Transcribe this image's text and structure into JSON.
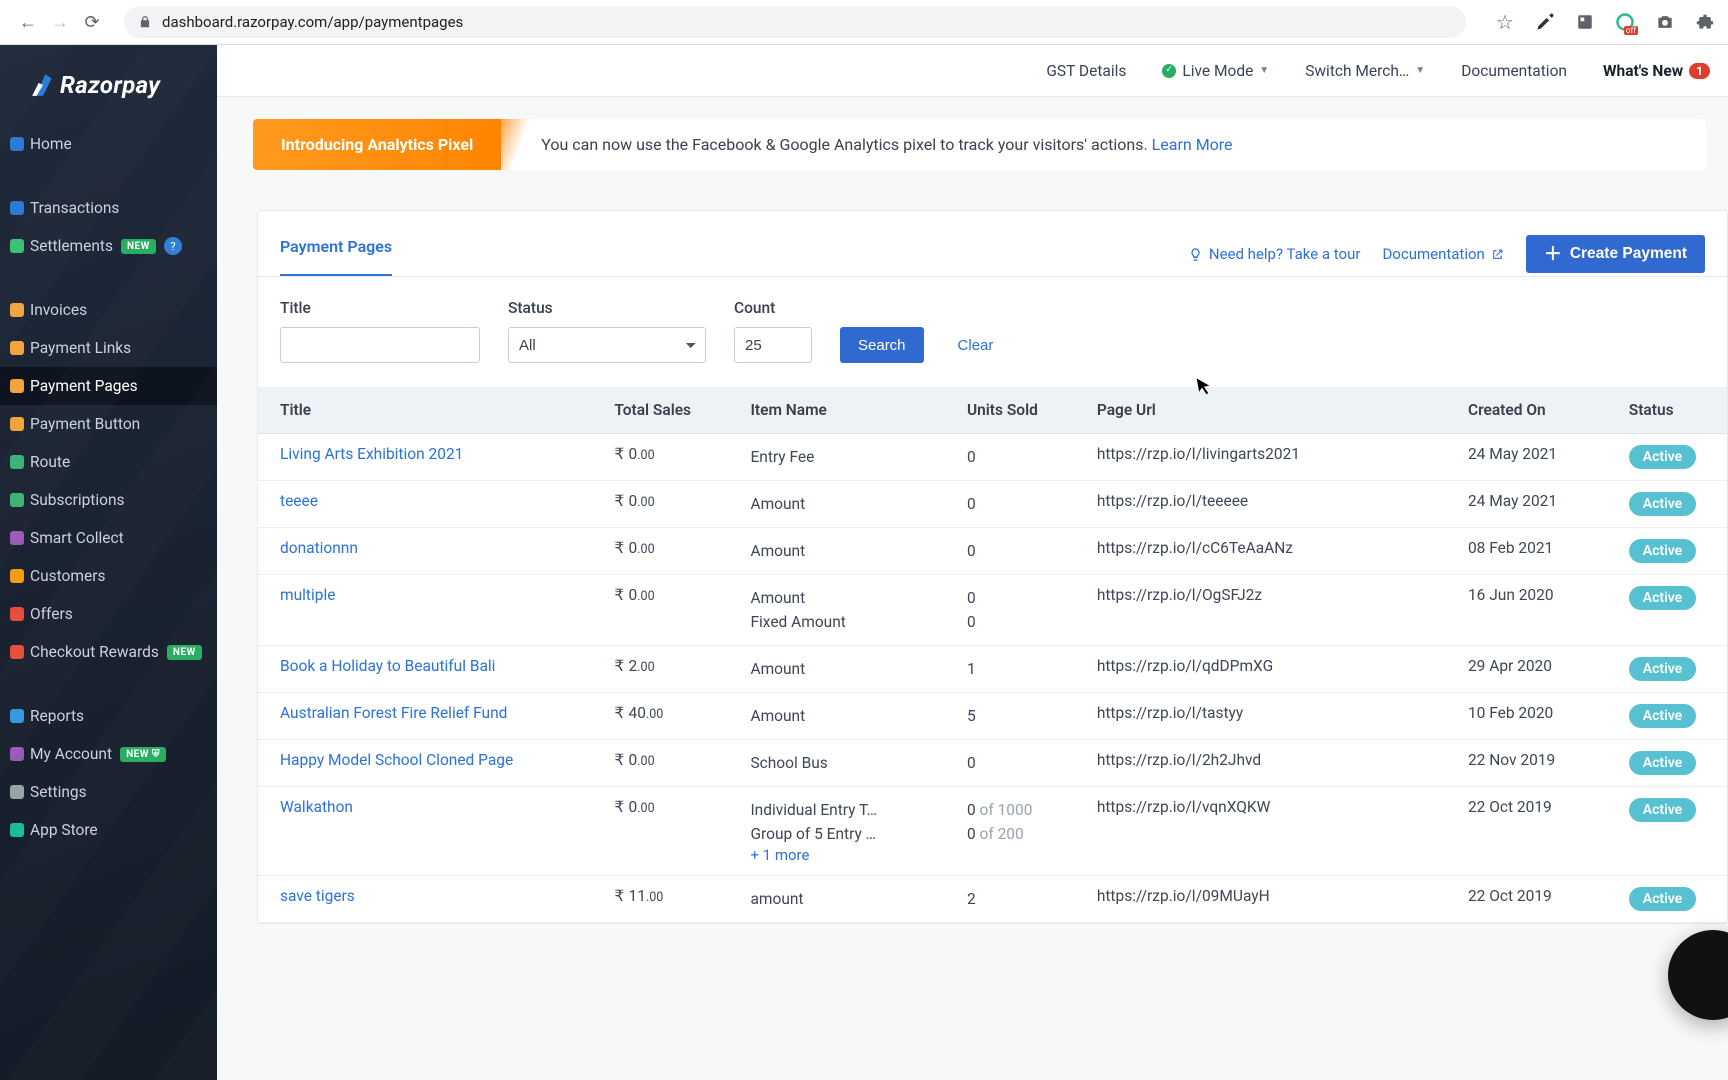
{
  "browser": {
    "url": "dashboard.razorpay.com/app/paymentpages"
  },
  "brand": {
    "name": "Razorpay"
  },
  "sidebar": {
    "items": [
      {
        "label": "Home",
        "color": "#2b7bd6"
      },
      {
        "label": "Transactions",
        "color": "#2b7bd6"
      },
      {
        "label": "Settlements",
        "color": "#38c172",
        "new": true,
        "info": true
      },
      {
        "label": "Invoices",
        "color": "#f2a33c"
      },
      {
        "label": "Payment Links",
        "color": "#f2a33c"
      },
      {
        "label": "Payment Pages",
        "color": "#f2a33c",
        "active": true
      },
      {
        "label": "Payment Button",
        "color": "#f2a33c"
      },
      {
        "label": "Route",
        "color": "#3bb273"
      },
      {
        "label": "Subscriptions",
        "color": "#3bb273"
      },
      {
        "label": "Smart Collect",
        "color": "#9b59b6"
      },
      {
        "label": "Customers",
        "color": "#f39c12"
      },
      {
        "label": "Offers",
        "color": "#e74c3c"
      },
      {
        "label": "Checkout Rewards",
        "color": "#e74c3c",
        "new": true
      },
      {
        "label": "Reports",
        "color": "#3498db"
      },
      {
        "label": "My Account",
        "color": "#9b59b6",
        "new": true,
        "shield": true
      },
      {
        "label": "Settings",
        "color": "#95a5a6"
      },
      {
        "label": "App Store",
        "color": "#1abc9c"
      }
    ],
    "newBadge": "NEW"
  },
  "topbar": {
    "gst": "GST Details",
    "mode": "Live Mode",
    "switch": "Switch Merch…",
    "docs": "Documentation",
    "whatsnew": "What's New",
    "whatsnewCount": "1"
  },
  "banner": {
    "tag": "Introducing Analytics Pixel",
    "text": "You can now use the Facebook & Google Analytics pixel to track your visitors' actions. ",
    "link": "Learn More"
  },
  "panel": {
    "tab": "Payment Pages",
    "help": "Need help? Take a tour",
    "docs": "Documentation",
    "createBtn": "Create Payment",
    "filters": {
      "titleLabel": "Title",
      "titleValue": "",
      "statusLabel": "Status",
      "statusValue": "All",
      "countLabel": "Count",
      "countValue": "25",
      "searchBtn": "Search",
      "clearBtn": "Clear"
    },
    "columns": {
      "title": "Title",
      "sales": "Total Sales",
      "item": "Item Name",
      "units": "Units Sold",
      "url": "Page Url",
      "created": "Created On",
      "status": "Status"
    },
    "moreTemplate": "+ 1 more",
    "rows": [
      {
        "title": "Living Arts Exhibition 2021",
        "salesWhole": "0",
        "salesDec": ".00",
        "items": [
          {
            "name": "Entry Fee",
            "units": "0"
          }
        ],
        "url": "https://rzp.io/l/livingarts2021",
        "date": "24 May 2021",
        "status": "Active"
      },
      {
        "title": "teeee",
        "salesWhole": "0",
        "salesDec": ".00",
        "items": [
          {
            "name": "Amount",
            "units": "0"
          }
        ],
        "url": "https://rzp.io/l/teeeee",
        "date": "24 May 2021",
        "status": "Active"
      },
      {
        "title": "donationnn",
        "salesWhole": "0",
        "salesDec": ".00",
        "items": [
          {
            "name": "Amount",
            "units": "0"
          }
        ],
        "url": "https://rzp.io/l/cC6TeAaANz",
        "date": "08 Feb 2021",
        "status": "Active"
      },
      {
        "title": "multiple",
        "salesWhole": "0",
        "salesDec": ".00",
        "items": [
          {
            "name": "Amount",
            "units": "0"
          },
          {
            "name": "Fixed Amount",
            "units": "0"
          }
        ],
        "url": "https://rzp.io/l/OgSFJ2z",
        "date": "16 Jun 2020",
        "status": "Active"
      },
      {
        "title": "Book a Holiday to Beautiful Bali",
        "salesWhole": "2",
        "salesDec": ".00",
        "items": [
          {
            "name": "Amount",
            "units": "1"
          }
        ],
        "url": "https://rzp.io/l/qdDPmXG",
        "date": "29 Apr 2020",
        "status": "Active"
      },
      {
        "title": "Australian Forest Fire Relief Fund",
        "salesWhole": "40",
        "salesDec": ".00",
        "items": [
          {
            "name": "Amount",
            "units": "5"
          }
        ],
        "url": "https://rzp.io/l/tastyy",
        "date": "10 Feb 2020",
        "status": "Active"
      },
      {
        "title": "Happy Model School Cloned Page",
        "salesWhole": "0",
        "salesDec": ".00",
        "items": [
          {
            "name": "School Bus",
            "units": "0"
          }
        ],
        "url": "https://rzp.io/l/2h2Jhvd",
        "date": "22 Nov 2019",
        "status": "Active"
      },
      {
        "title": "Walkathon",
        "salesWhole": "0",
        "salesDec": ".00",
        "items": [
          {
            "name": "Individual Entry T…",
            "units": "0",
            "cap": "of 1000"
          },
          {
            "name": "Group of 5 Entry …",
            "units": "0",
            "cap": "of 200"
          }
        ],
        "more": true,
        "url": "https://rzp.io/l/vqnXQKW",
        "date": "22 Oct 2019",
        "status": "Active"
      },
      {
        "title": "save tigers",
        "salesWhole": "11",
        "salesDec": ".00",
        "items": [
          {
            "name": "amount",
            "units": "2"
          }
        ],
        "url": "https://rzp.io/l/09MUayH",
        "date": "22 Oct 2019",
        "status": "Active"
      }
    ]
  }
}
